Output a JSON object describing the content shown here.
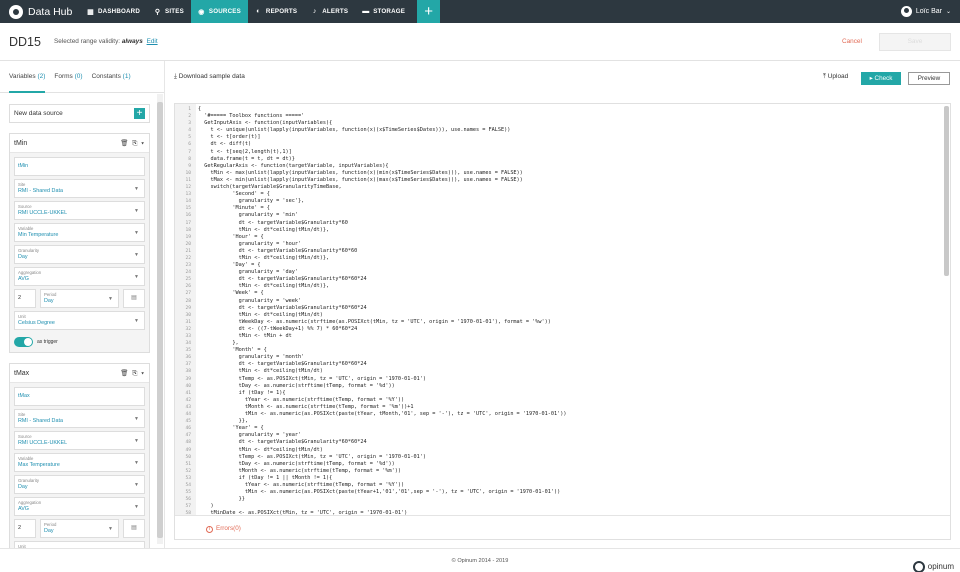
{
  "app": {
    "name": "Data Hub",
    "user": "Loïc Bar"
  },
  "nav": [
    {
      "icon": "grid-icon",
      "glyph": "▦",
      "label": "DASHBOARD"
    },
    {
      "icon": "pin-icon",
      "glyph": "⚲",
      "label": "SITES"
    },
    {
      "icon": "sources-icon",
      "glyph": "◉",
      "label": "SOURCES",
      "active": true
    },
    {
      "icon": "reports-icon",
      "glyph": "◐",
      "label": "REPORTS"
    },
    {
      "icon": "bell-icon",
      "glyph": "♪",
      "label": "ALERTS"
    },
    {
      "icon": "folder-icon",
      "glyph": "▬",
      "label": "STORAGE"
    }
  ],
  "header": {
    "title": "DD15",
    "validity_label": "Selected range validity:",
    "validity_value": "always",
    "edit": "Edit",
    "cancel": "Cancel",
    "save": "Save"
  },
  "sidebar": {
    "tabs": [
      {
        "label": "Variables",
        "count": "(2)"
      },
      {
        "label": "Forms",
        "count": "(0)"
      },
      {
        "label": "Constants",
        "count": "(1)"
      }
    ],
    "new_data_source": "New data source",
    "cards": [
      {
        "name": "tMin",
        "fields": [
          {
            "label": "",
            "value": "tMin"
          },
          {
            "label": "Site",
            "value": "RMI - Shared Data"
          },
          {
            "label": "Source",
            "value": "RMI UCCLE-UKKEL"
          },
          {
            "label": "Variable",
            "value": "Min Temperature"
          },
          {
            "label": "Granularity",
            "value": "Day"
          },
          {
            "label": "Aggregation",
            "value": "AVG"
          }
        ],
        "period_num": "2",
        "period_label": "Period",
        "period_value": "Day",
        "unit_label": "Unit",
        "unit_value": "Celsius Degree",
        "trigger": "as trigger"
      },
      {
        "name": "tMax",
        "fields": [
          {
            "label": "",
            "value": "tMax"
          },
          {
            "label": "Site",
            "value": "RMI - Shared Data"
          },
          {
            "label": "Source",
            "value": "RMI UCCLE-UKKEL"
          },
          {
            "label": "Variable",
            "value": "Max Temperature"
          },
          {
            "label": "Granularity",
            "value": "Day"
          },
          {
            "label": "Aggregation",
            "value": "AVG"
          }
        ],
        "period_num": "2",
        "period_label": "Period",
        "period_value": "Day",
        "unit_label": "Unit",
        "unit_value": ""
      }
    ]
  },
  "main": {
    "download": "Download sample data",
    "upload": "Upload",
    "check": "Check",
    "preview": "Preview",
    "errors": "Errors(0)"
  },
  "code": [
    "{",
    "  '#===== Toolbox functions =====' ",
    "  GetInputAxis <- function(inputVariables){",
    "    t <- unique(unlist(lapply(inputVariables, function(x)(x$TimeSeries$Dates))), use.names = FALSE))",
    "    t <- t[order(t)]",
    "    dt <- diff(t)",
    "    t <- t[seq(2,length(t),1)]",
    "    data.frame(t = t, dt = dt)}",
    "  GetRegularAxis <- function(targetVariable, inputVariables){",
    "    tMin <- max(unlist(lapply(inputVariables, function(x)(min(x$TimeSeries$Dates))), use.names = FALSE))",
    "    tMax <- min(unlist(lapply(inputVariables, function(x)(max(x$TimeSeries$Dates))), use.names = FALSE))",
    "    switch(targetVariable$GranularityTimeBase,",
    "           'Second' = {",
    "             granularity = 'sec'},",
    "           'Minute' = {",
    "             granularity = 'min'",
    "             dt <- targetVariable$Granularity*60",
    "             tMin <- dt*ceiling(tMin/dt)},",
    "           'Hour' = {",
    "             granularity = 'hour'",
    "             dt <- targetVariable$Granularity*60*60",
    "             tMin <- dt*ceiling(tMin/dt)},",
    "           'Day' = {",
    "             granularity = 'day'",
    "             dt <- targetVariable$Granularity*60*60*24",
    "             tMin <- dt*ceiling(tMin/dt)},",
    "           'Week' = {",
    "             granularity = 'week'",
    "             dt <- targetVariable$Granularity*60*60*24",
    "             tMin <- dt*ceiling(tMin/dt)",
    "             tWeekDay <- as.numeric(strftime(as.POSIXct(tMin, tz = 'UTC', origin = '1970-01-01'), format = '%w'))",
    "             dt <- ((7-tWeekDay+1) %% 7) * 60*60*24",
    "             tMin <- tMin + dt",
    "           },",
    "           'Month' = {",
    "             granularity = 'month'",
    "             dt <- targetVariable$Granularity*60*60*24",
    "             tMin <- dt*ceiling(tMin/dt)",
    "             tTemp <- as.POSIXct(tMin, tz = 'UTC', origin = '1970-01-01')",
    "             tDay <- as.numeric(strftime(tTemp, format = '%d'))",
    "             if (tDay != 1){",
    "               tYear <- as.numeric(strftime(tTemp, format = '%Y'))",
    "               tMonth <- as.numeric(strftime(tTemp, format = '%m'))+1",
    "               tMin <- as.numeric(as.POSIXct(paste(tYear, tMonth,'01', sep = '-'), tz = 'UTC', origin = '1970-01-01'))",
    "             }},",
    "           'Year' = {",
    "             granularity = 'year'",
    "             dt <- targetVariable$Granularity*60*60*24",
    "             tMin <- dt*ceiling(tMin/dt)",
    "             tTemp <- as.POSIXct(tMin, tz = 'UTC', origin = '1970-01-01')",
    "             tDay <- as.numeric(strftime(tTemp, format = '%d'))",
    "             tMonth <- as.numeric(strftime(tTemp, format = '%m'))",
    "             if (tDay != 1 || tMonth != 1){",
    "               tYear <- as.numeric(strftime(tTemp, format = '%Y'))",
    "               tMin <- as.numeric(as.POSIXct(paste(tYear+1,'01','01',sep = '-'), tz = 'UTC', origin = '1970-01-01'))",
    "             }}",
    "    )",
    "    tMinDate <- as.POSIXct(tMin, tz = 'UTC', origin = '1970-01-01')"
  ],
  "footer": {
    "copyright": "© Opinum 2014 - 2019",
    "brand": "opinum"
  }
}
